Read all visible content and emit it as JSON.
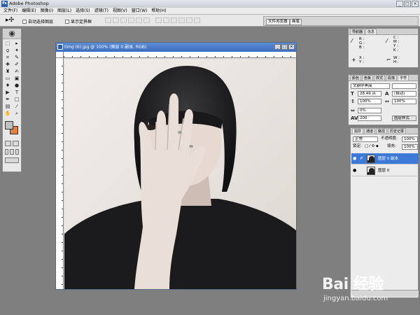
{
  "app": {
    "title": "Adobe Photoshop",
    "icon": "photoshop-app-icon"
  },
  "window_buttons": [
    "_",
    "□",
    "×"
  ],
  "menu": [
    "文件(F)",
    "编辑(E)",
    "图像(I)",
    "图层(L)",
    "选择(S)",
    "滤镜(T)",
    "视图(V)",
    "窗口(W)",
    "帮助(H)"
  ],
  "options": {
    "auto_select_layer": "自动选择图层",
    "show_bounding_box": "显示定界框",
    "well_tabs": [
      "文件浏览器",
      "画笔"
    ]
  },
  "document": {
    "title": "timg (6).jpg @ 100% (图层 0 副本, RGB)",
    "buttons": [
      "_",
      "□",
      "×"
    ]
  },
  "navigator_panel": {
    "tabs": [
      "导航器",
      "信息"
    ],
    "info": {
      "rgb_r": "R :",
      "rgb_g": "G :",
      "rgb_b": "B :",
      "cmyk_c": "C :",
      "cmyk_m": "M :",
      "cmyk_y": "Y :",
      "cmyk_k": "K :",
      "x": "X :",
      "y": "Y :",
      "w": "W :",
      "h": "H :"
    }
  },
  "character_panel": {
    "tabs": [
      "颜色",
      "色板",
      "样式",
      "段落",
      "字符"
    ],
    "font_family": "文鼎中黑简",
    "font_size": "28.49 点",
    "leading": "(自动)",
    "vertical_scale": "100%",
    "horizontal_scale": "100%",
    "tracking": "0%",
    "kerning": "200",
    "anti_alias": "图层样式"
  },
  "layers_panel": {
    "tabs": [
      "图层",
      "通道",
      "路径",
      "历史记录"
    ],
    "blend_mode": "正常",
    "opacity_label": "不透明度:",
    "opacity": "100%",
    "lock_label": "锁定:",
    "fill_label": "填充:",
    "fill": "100%",
    "layers": [
      {
        "name": "图层 0 副本",
        "selected": true
      },
      {
        "name": "图层 0",
        "selected": false
      }
    ]
  },
  "watermark": {
    "main": "Bai 经验",
    "sub": "jingyan.baidu.com"
  },
  "colors": {
    "foreground": "#c0c0c0",
    "background": "#e0803c",
    "selection": "#3d7ad8"
  }
}
